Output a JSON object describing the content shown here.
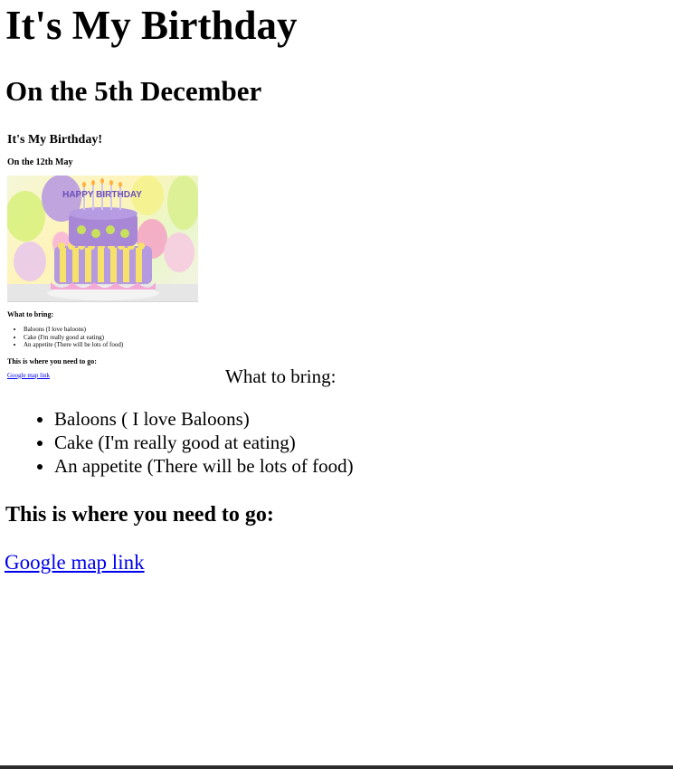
{
  "page": {
    "title": "It's My Birthday",
    "subtitle": "On the 5th December",
    "bring_heading": "What to bring:",
    "bring_items": [
      "Baloons ( I love Baloons)",
      "Cake (I'm really good at eating)",
      "An appetite (There will be lots of food)"
    ],
    "where_heading": "This is where you need to go:",
    "map_link": "Google map link"
  },
  "thumbnail": {
    "title": "It's My Birthday!",
    "subtitle": "On the 12th May",
    "cake_text": "HAPPY BIRTHDAY",
    "bring_heading": "What to bring:",
    "bring_items": [
      "Baloons (I love baloons)",
      "Cake (I'm really good at eating)",
      "An appetite (There will be lots of food)"
    ],
    "where_heading": "This is where you need to go:",
    "map_link": "Google map link"
  },
  "colors": {
    "link": "#0000ee",
    "text": "#000000",
    "background": "#ffffff",
    "bottom_bar": "#2b2b2b"
  }
}
